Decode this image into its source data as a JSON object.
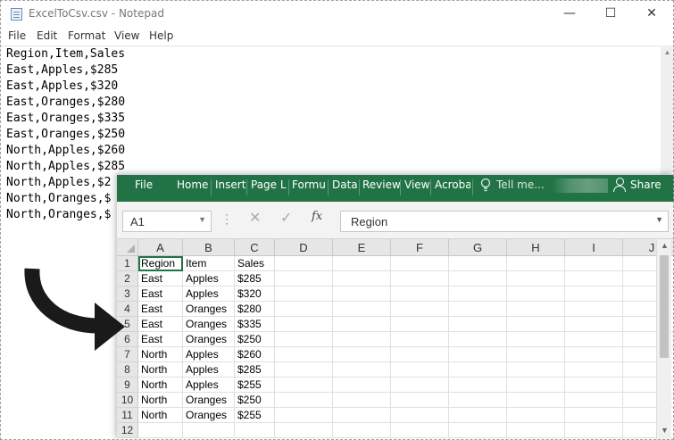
{
  "notepad": {
    "title": "ExcelToCsv.csv - Notepad",
    "window_buttons": {
      "minimize": "—",
      "maximize": "☐",
      "close": "✕"
    },
    "menu": [
      "File",
      "Edit",
      "Format",
      "View",
      "Help"
    ],
    "lines": [
      "Region,Item,Sales",
      "East,Apples,$285",
      "East,Apples,$320",
      "East,Oranges,$280",
      "East,Oranges,$335",
      "East,Oranges,$250",
      "North,Apples,$260",
      "North,Apples,$285",
      "North,Apples,$2",
      "North,Oranges,$",
      "North,Oranges,$"
    ]
  },
  "excel": {
    "ribbon_tabs": [
      "File",
      "Home",
      "Insert",
      "Page Li",
      "Formu",
      "Data",
      "Review",
      "View",
      "Acroba"
    ],
    "tell_me": "Tell me...",
    "share": "Share",
    "name_box": "A1",
    "formula_value": "Region",
    "formula_fx": "fx",
    "columns": [
      "A",
      "B",
      "C",
      "D",
      "E",
      "F",
      "G",
      "H",
      "I",
      "J"
    ],
    "rows": [
      {
        "n": "1",
        "cells": [
          "Region",
          "Item",
          "Sales"
        ]
      },
      {
        "n": "2",
        "cells": [
          "East",
          "Apples",
          "$285"
        ]
      },
      {
        "n": "3",
        "cells": [
          "East",
          "Apples",
          "$320"
        ]
      },
      {
        "n": "4",
        "cells": [
          "East",
          "Oranges",
          "$280"
        ]
      },
      {
        "n": "5",
        "cells": [
          "East",
          "Oranges",
          "$335"
        ]
      },
      {
        "n": "6",
        "cells": [
          "East",
          "Oranges",
          "$250"
        ]
      },
      {
        "n": "7",
        "cells": [
          "North",
          "Apples",
          "$260"
        ]
      },
      {
        "n": "8",
        "cells": [
          "North",
          "Apples",
          "$285"
        ]
      },
      {
        "n": "9",
        "cells": [
          "North",
          "Apples",
          "$255"
        ]
      },
      {
        "n": "10",
        "cells": [
          "North",
          "Oranges",
          "$250"
        ]
      },
      {
        "n": "11",
        "cells": [
          "North",
          "Oranges",
          "$255"
        ]
      },
      {
        "n": "12",
        "cells": [
          "",
          "",
          ""
        ]
      }
    ],
    "accent_color": "#217346"
  }
}
